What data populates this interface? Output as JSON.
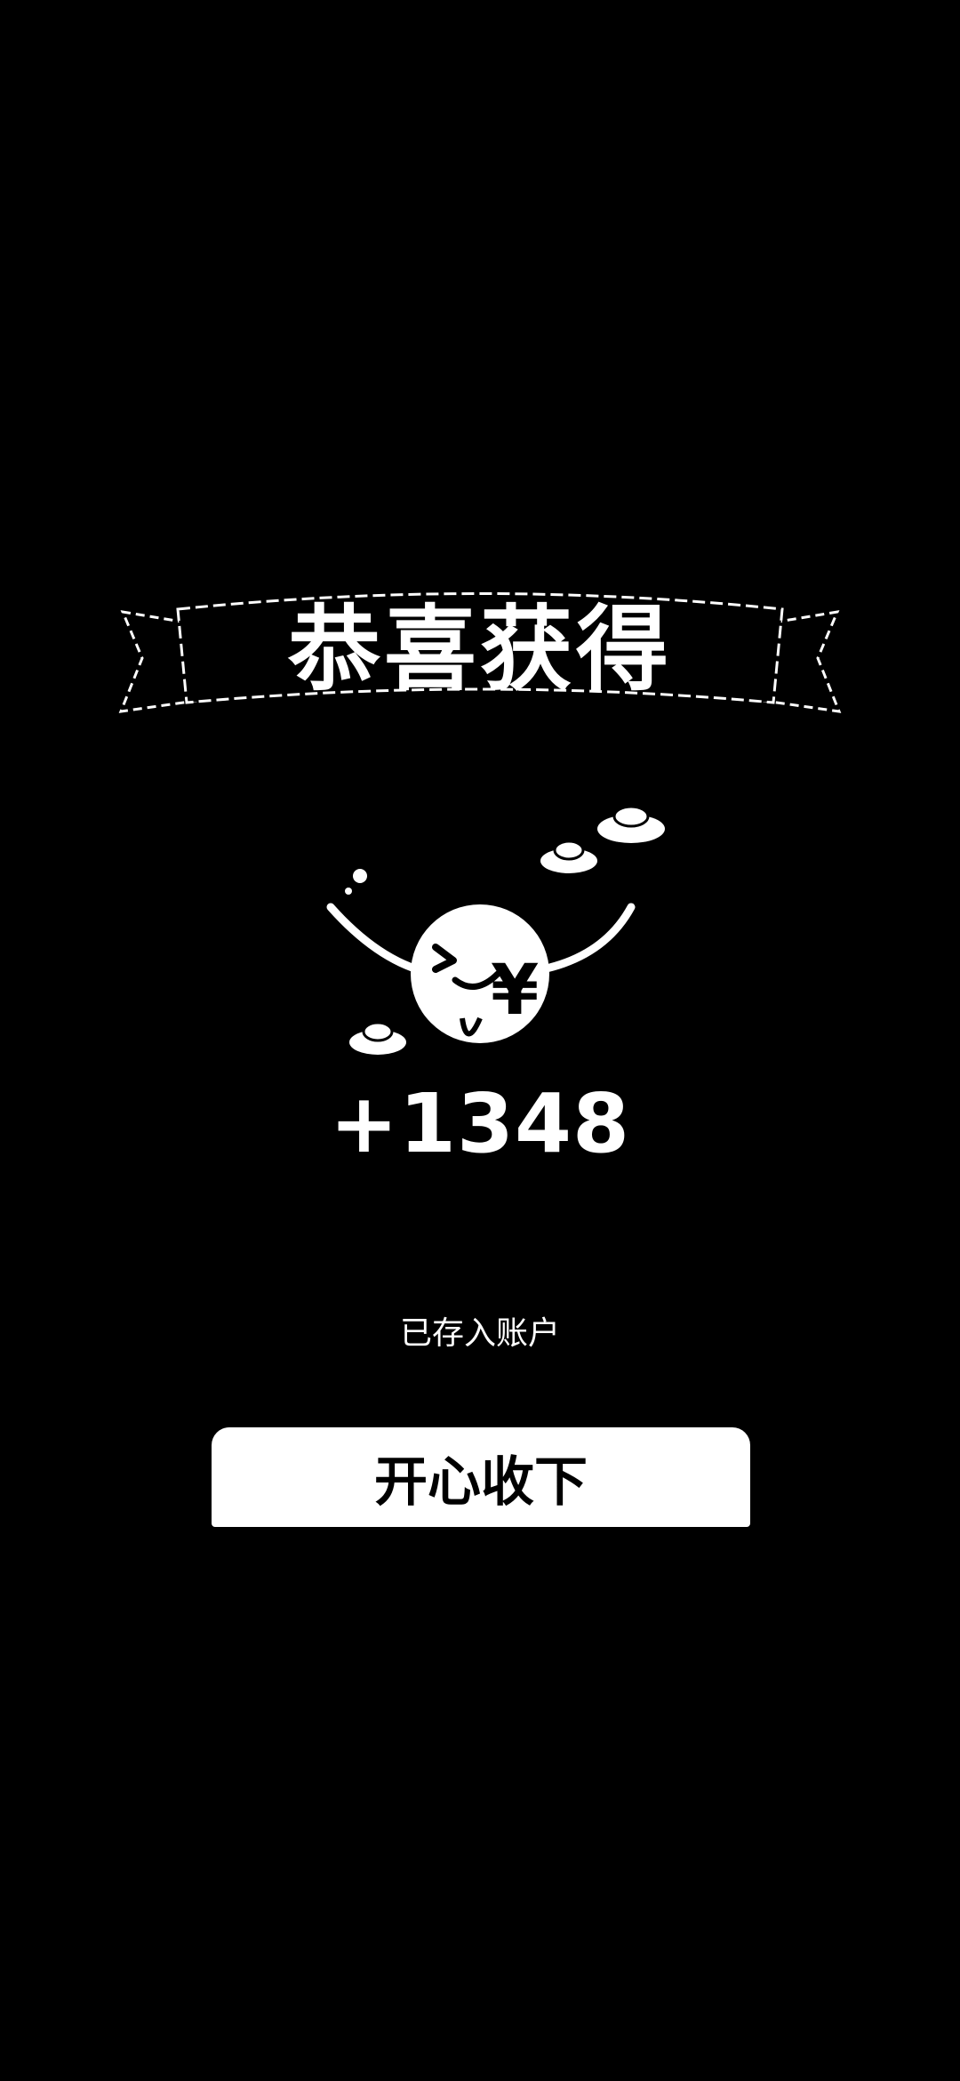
{
  "dialog": {
    "title": "恭喜获得",
    "amount": "+1348",
    "status_text": "已存入账户",
    "confirm_button_label": "开心收下"
  },
  "icons": {
    "banner": "ribbon-banner-icon",
    "mascot": "money-face-mascot-icon",
    "ingots": "gold-ingot-icon"
  },
  "colors": {
    "background": "#000000",
    "foreground": "#ffffff"
  }
}
